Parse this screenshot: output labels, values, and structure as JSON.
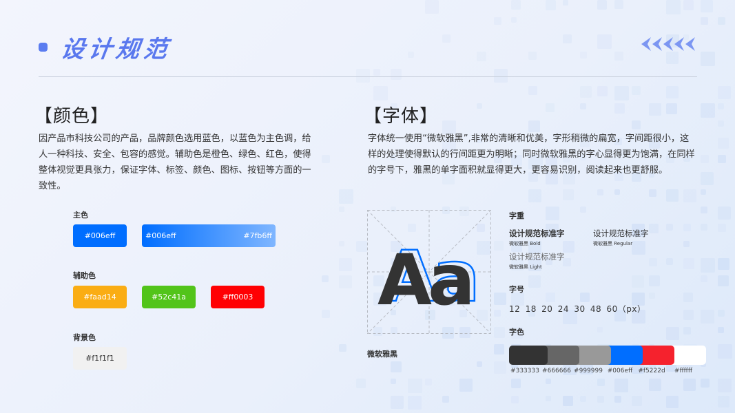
{
  "header": {
    "title": "设计规范"
  },
  "color_section": {
    "title": "【颜色】",
    "description": "因产品市科技公司的产品，品牌颜色选用蓝色，以蓝色为主色调，给人一种科技、安全、包容的感觉。辅助色是橙色、绿色、红色，使得整体视觉更具张力，保证字体、标签、颜色、图标、按钮等方面的一致性。",
    "primary": {
      "label": "主色",
      "solid": {
        "hex": "#006eff",
        "text": "#006eff"
      },
      "gradient": {
        "from": "#006eff",
        "to": "#7fb6ff",
        "from_text": "#006eff",
        "to_text": "#7fb6ff"
      }
    },
    "secondary": {
      "label": "辅助色",
      "swatches": [
        {
          "hex": "#faad14",
          "text": "#faad14"
        },
        {
          "hex": "#52c41a",
          "text": "#52c41a"
        },
        {
          "hex": "#ff0003",
          "text": "#ff0003"
        }
      ]
    },
    "background": {
      "label": "背景色",
      "swatch": {
        "hex": "#f1f1f1",
        "text": "#f1f1f1"
      }
    }
  },
  "font_section": {
    "title": "【字体】",
    "description": "字体统一使用“微软雅黑”,非常的清晰和优美，字形稍微的扁宽，字间距很小，这样的处理使得默认的行间距更为明晰；同时微软雅黑的字心显得更为饱满，在同样的字号下，雅黑的单字面积就显得更大，更容易识别，阅读起来也更舒服。",
    "specimen": "Aa",
    "font_name": "微软雅黑",
    "weight": {
      "label": "字重",
      "samples": [
        {
          "text": "设计规范标准字",
          "sub": "微软雅黑  Bold"
        },
        {
          "text": "设计规范标准字",
          "sub": "微软雅黑  Regular"
        },
        {
          "text": "设计规范标准字",
          "sub": "微软雅黑  Light"
        }
      ]
    },
    "sizes": {
      "label": "字号",
      "text": "12  18  20  24  30  48  60（px）"
    },
    "text_colors": {
      "label": "字色",
      "items": [
        {
          "hex": "#333333",
          "text": "#333333"
        },
        {
          "hex": "#666666",
          "text": "#666666"
        },
        {
          "hex": "#999999",
          "text": "#999999"
        },
        {
          "hex": "#006eff",
          "text": "#006eff"
        },
        {
          "hex": "#f5222d",
          "text": "#f5222d"
        },
        {
          "hex": "#ffffff",
          "text": "#ffffff"
        }
      ]
    }
  }
}
